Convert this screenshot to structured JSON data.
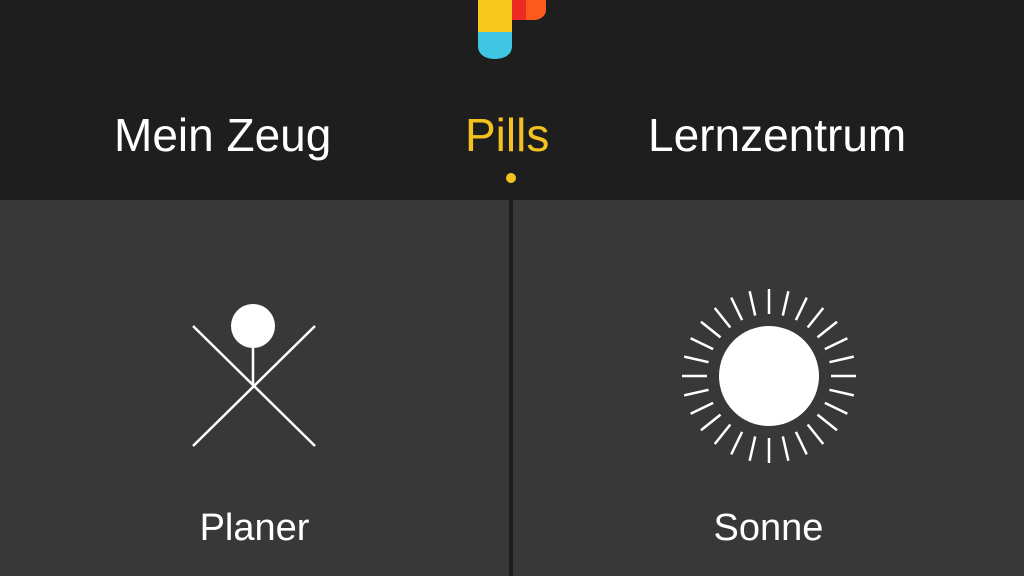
{
  "colors": {
    "background": "#1e1e1e",
    "tile": "#383838",
    "active_tab": "#f4c21e",
    "inactive_tab": "#ffffff",
    "logo_yellow": "#f8c81c",
    "logo_blue": "#3fc6e2",
    "logo_orange": "#fb5a1c",
    "logo_red": "#ee2a24"
  },
  "header": {
    "logo_icon": "app-logo",
    "tabs": [
      {
        "label": "Mein Zeug",
        "active": false
      },
      {
        "label": "Pills",
        "active": true
      },
      {
        "label": "Lernzentrum",
        "active": false
      }
    ]
  },
  "tiles": [
    {
      "label": "Planer",
      "icon": "planer-figure-icon"
    },
    {
      "label": "Sonne",
      "icon": "sun-icon"
    }
  ]
}
